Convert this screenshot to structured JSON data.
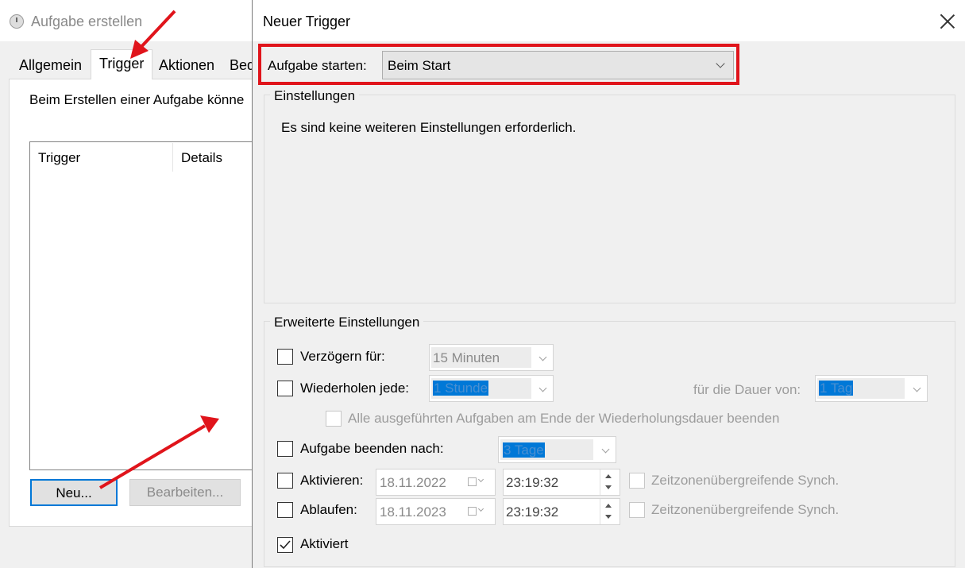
{
  "background_window": {
    "title": "Aufgabe erstellen",
    "tabs": [
      "Allgemein",
      "Trigger",
      "Aktionen",
      "Bed"
    ],
    "active_tab": "Trigger",
    "description": "Beim Erstellen einer Aufgabe könne",
    "list_columns": [
      "Trigger",
      "Details"
    ],
    "buttons": {
      "new": "Neu...",
      "edit": "Bearbeiten..."
    }
  },
  "dialog": {
    "title": "Neuer Trigger",
    "start_label": "Aufgabe starten:",
    "start_value": "Beim Start",
    "settings": {
      "title": "Einstellungen",
      "text": "Es sind keine weiteren Einstellungen erforderlich."
    },
    "advanced": {
      "title": "Erweiterte Einstellungen",
      "delay": {
        "label": "Verzögern für:",
        "value": "15 Minuten",
        "checked": false
      },
      "repeat": {
        "label": "Wiederholen jede:",
        "value": "1 Stunde",
        "checked": false,
        "duration_label": "für die Dauer von:",
        "duration_value": "1 Tag"
      },
      "stop_all": {
        "label": "Alle ausgeführten Aufgaben am Ende der Wiederholungsdauer beenden",
        "checked": false
      },
      "stop_after": {
        "label": "Aufgabe beenden nach:",
        "value": "3 Tage",
        "checked": false
      },
      "activate": {
        "label": "Aktivieren:",
        "date": "18.11.2022",
        "time": "23:19:32",
        "checked": false,
        "sync_label": "Zeitzonenübergreifende Synch."
      },
      "expire": {
        "label": "Ablaufen:",
        "date": "18.11.2023",
        "time": "23:19:32",
        "checked": false,
        "sync_label": "Zeitzonenübergreifende Synch."
      },
      "enabled": {
        "label": "Aktiviert",
        "checked": true
      }
    }
  },
  "colors": {
    "annotation": "#e0141b",
    "selection": "#0078d7",
    "focus_border": "#0078d7"
  }
}
